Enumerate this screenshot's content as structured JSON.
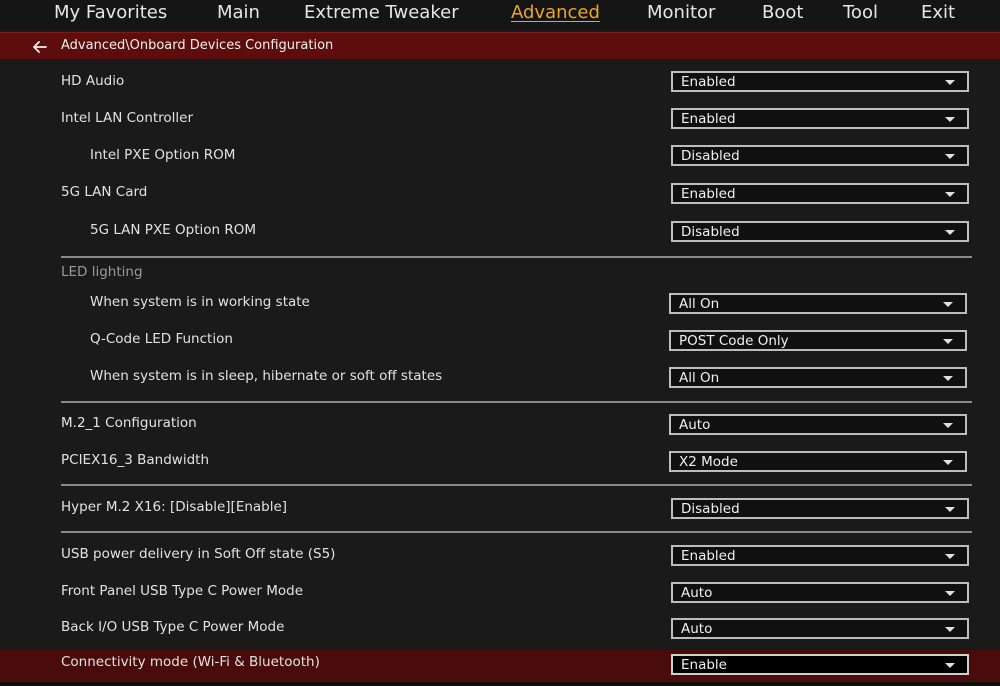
{
  "nav": {
    "tabs": [
      {
        "label": "My Favorites"
      },
      {
        "label": "Main"
      },
      {
        "label": "Extreme Tweaker"
      },
      {
        "label": "Advanced"
      },
      {
        "label": "Monitor"
      },
      {
        "label": "Boot"
      },
      {
        "label": "Tool"
      },
      {
        "label": "Exit"
      }
    ],
    "active": "Advanced"
  },
  "breadcrumb": "Advanced\\Onboard Devices Configuration",
  "settings": [
    {
      "label": "HD Audio",
      "value": "Enabled"
    },
    {
      "label": "Intel LAN Controller",
      "value": "Enabled"
    },
    {
      "label": "Intel PXE Option ROM",
      "value": "Disabled"
    },
    {
      "label": "5G LAN Card",
      "value": "Enabled"
    },
    {
      "label": "5G LAN PXE Option ROM",
      "value": "Disabled"
    },
    {
      "label": "When system is in working state",
      "value": "All On"
    },
    {
      "label": "Q-Code LED Function",
      "value": "POST Code Only"
    },
    {
      "label": "When system is in sleep, hibernate or soft off states",
      "value": "All On"
    },
    {
      "label": "M.2_1 Configuration",
      "value": "Auto"
    },
    {
      "label": "PCIEX16_3 Bandwidth",
      "value": "X2 Mode"
    },
    {
      "label": "Hyper M.2 X16: [Disable][Enable]",
      "value": "Disabled"
    },
    {
      "label": "USB power delivery in Soft Off state (S5)",
      "value": "Enabled"
    },
    {
      "label": "Front Panel USB Type C Power Mode",
      "value": "Auto"
    },
    {
      "label": "Back I/O USB Type C Power Mode",
      "value": "Auto"
    },
    {
      "label": "Connectivity mode (Wi-Fi & Bluetooth)",
      "value": "Enable"
    }
  ],
  "sections": {
    "led_lighting": "LED lighting"
  },
  "colors": {
    "accent": "#e8a530",
    "header_bar": "#5e0d0d",
    "selected_row": "#4a0b0b",
    "background": "#1a1a1a"
  }
}
